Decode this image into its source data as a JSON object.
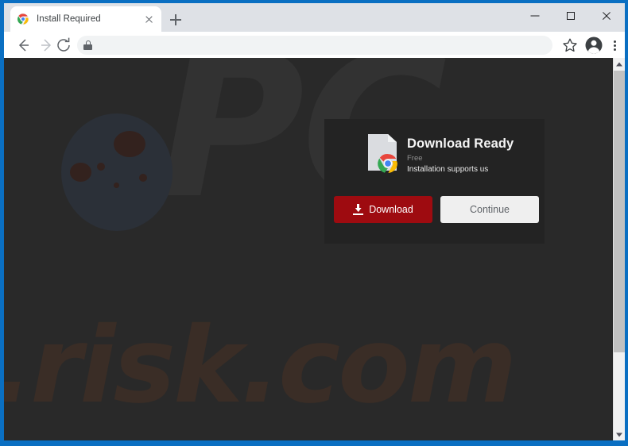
{
  "browser": {
    "tab": {
      "title": "Install Required",
      "favicon_icon": "chrome-favicon-icon",
      "close_icon": "close-icon"
    },
    "new_tab_icon": "plus-icon",
    "window_controls": {
      "minimize_icon": "minimize-icon",
      "maximize_icon": "maximize-icon",
      "close_icon": "close-icon"
    },
    "toolbar": {
      "back_icon": "arrow-left-icon",
      "forward_icon": "arrow-right-icon",
      "reload_icon": "reload-icon",
      "lock_icon": "lock-icon",
      "url": "",
      "url_placeholder": "",
      "bookmark_icon": "star-icon",
      "profile_icon": "account-avatar-icon",
      "menu_icon": "three-dot-menu-icon"
    },
    "scrollbar": {
      "up_icon": "chevron-up-icon",
      "down_icon": "chevron-down-icon"
    }
  },
  "page": {
    "watermark_primary": "PC",
    "watermark_secondary": ".risk.com",
    "dialog": {
      "file_icon": "document-with-chrome-logo-icon",
      "title": "Download Ready",
      "subtitle_price": "Free",
      "subtitle_note": "Installation supports us",
      "download_button": {
        "label": "Download",
        "icon": "download-arrow-icon",
        "color": "#9e0b10"
      },
      "continue_button": {
        "label": "Continue",
        "color": "#efefef"
      }
    }
  },
  "colors": {
    "window_frame": "#0a6fc2",
    "page_background": "#292929",
    "dialog_background": "#222222",
    "accent_red": "#9e0b10"
  }
}
